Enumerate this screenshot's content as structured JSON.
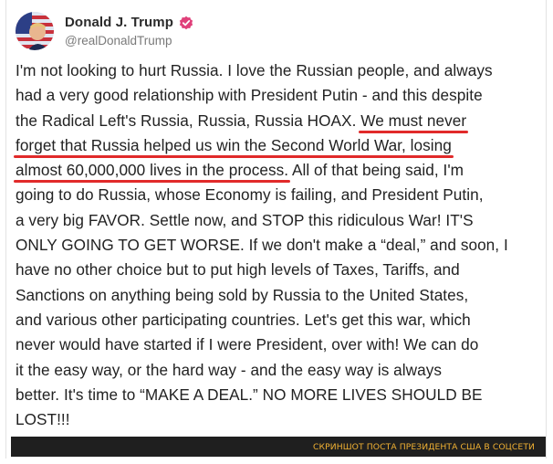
{
  "author": {
    "display_name": "Donald J. Trump",
    "handle": "@realDonaldTrump",
    "verified_icon": "verified-badge-icon",
    "verified_color": "#e0407a"
  },
  "post": {
    "lines": [
      [
        {
          "t": "I'm not looking to hurt Russia. I love the Russian people, and always"
        }
      ],
      [
        {
          "t": "had a very good relationship with President Putin - and this despite"
        }
      ],
      [
        {
          "t": "the Radical Left's Russia, Russia, Russia HOAX. "
        },
        {
          "t": "We must never",
          "u": true
        }
      ],
      [
        {
          "t": "forget that Russia helped us win the Second World War, losing",
          "u": true
        }
      ],
      [
        {
          "t": "almost 60,000,000 lives in the process.",
          "u": true
        },
        {
          "t": " All of that being said, I'm"
        }
      ],
      [
        {
          "t": "going to do Russia, whose Economy is failing, and President Putin,"
        }
      ],
      [
        {
          "t": "a very big FAVOR. Settle now, and STOP this ridiculous War! IT'S"
        }
      ],
      [
        {
          "t": "ONLY GOING TO GET WORSE. If we don't make a “deal,” and soon, I"
        }
      ],
      [
        {
          "t": "have no other choice but to put high levels of Taxes, Tariffs, and"
        }
      ],
      [
        {
          "t": "Sanctions on anything being sold by Russia to the United States,"
        }
      ],
      [
        {
          "t": "and various other participating countries. Let's get this war, which"
        }
      ],
      [
        {
          "t": "never would have started if I were President, over with! We can do"
        }
      ],
      [
        {
          "t": "it the easy way, or the hard way - and the easy way is always"
        }
      ],
      [
        {
          "t": "better. It's time to “MAKE A DEAL.” NO MORE LIVES SHOULD BE"
        }
      ],
      [
        {
          "t": "LOST!!!"
        }
      ]
    ],
    "highlight_color": "#e12a2a"
  },
  "caption": {
    "text": "СКРИНШОТ ПОСТА ПРЕЗИДЕНТА США В СОЦСЕТИ",
    "bar_color": "#1f1f1f",
    "text_color": "#f2b233"
  }
}
